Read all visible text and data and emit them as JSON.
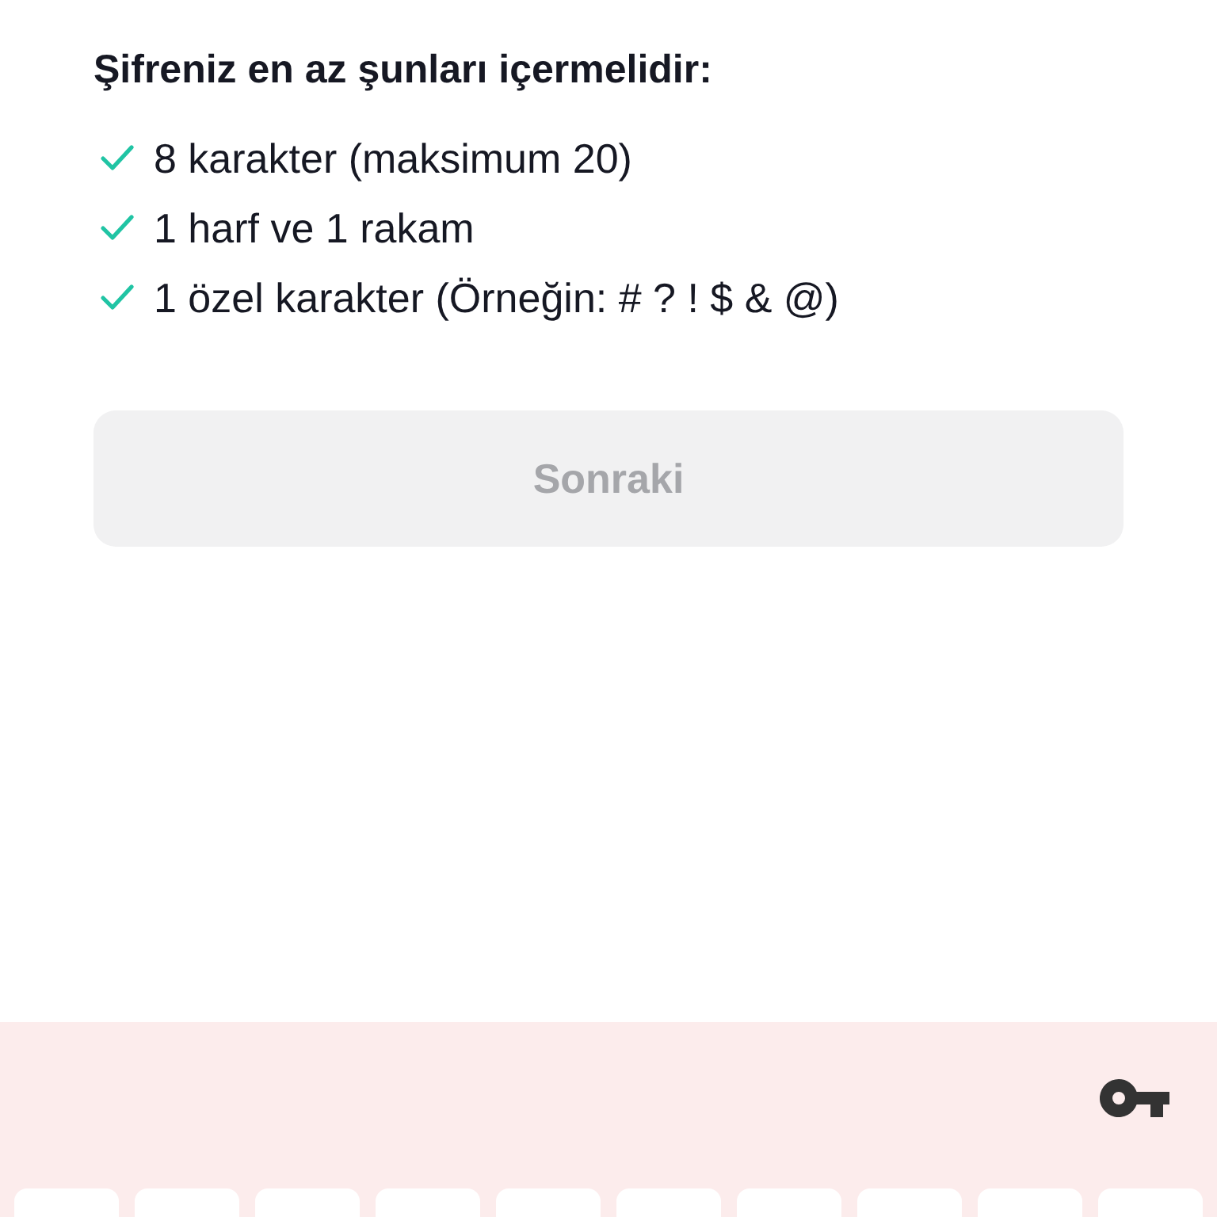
{
  "heading": "Şifreniz en az şunları içermelidir:",
  "requirements": [
    {
      "text": "8 karakter (maksimum 20)",
      "met": true
    },
    {
      "text": "1 harf ve 1 rakam",
      "met": true
    },
    {
      "text": "1 özel karakter (Örneğin: # ? ! $ & @)",
      "met": true
    }
  ],
  "next_button": {
    "label": "Sonraki",
    "disabled": true
  }
}
